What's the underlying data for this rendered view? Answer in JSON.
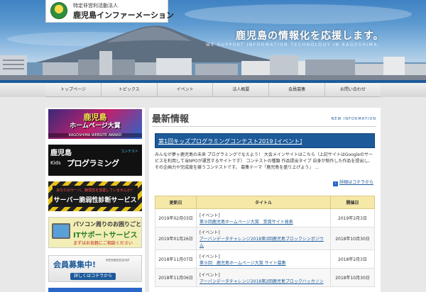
{
  "header": {
    "logo_sub": "特定非営利活動法人",
    "logo_main": "鹿児島インファーメーション",
    "tagline": "鹿児島の情報化を応援します。",
    "tagline_en": "WE SUPPORT INFORMATION TECHNOLOGY IN KAGOSHIMA."
  },
  "nav": {
    "items": [
      "トップページ",
      "トピックス",
      "イベント",
      "法人概要",
      "会員募集",
      "お問い合わせ"
    ]
  },
  "sidebar": {
    "banner1": {
      "line1": "鹿児島",
      "line2": "ホームページ大賞",
      "line3": "KAGOSHIMA WEBSITE AWARD"
    },
    "banner2": {
      "line1": "鹿児島",
      "line2": "Kids",
      "line3": "プログラミング",
      "line4": "コンテスト"
    },
    "banner3": {
      "line1": "あなたのサーバ、脆弱性を放置していませんか？",
      "line2": "サーバー脆弱性診断サービス"
    },
    "banner4": {
      "line1": "パソコン周りのお困りごと",
      "line2": "ITサポートサービス",
      "line3": "まずはお気軽にご相談ください"
    },
    "banner5": {
      "line1": "会員募集中!",
      "line2": "MEMBERSHIP",
      "line3": "詳しくはコチラから"
    }
  },
  "main": {
    "title": "最新情報",
    "title_en": "NEW INFORMATION",
    "article": {
      "heading": "第1回キッズプログラミングコンテスト2019 [イベント]",
      "body": "みんなが夢ヶ鹿児島の未来 プログラミングでなえよう！ 大会メインサイトはこちら（上記サイトはGoogleのサービスを利用して当NPOが運営するサイトです） コンテストの種類 作品提出タイプ 自身が制作した作品を提出し、その企画力や完成度を競うコンテストです。 募集テーマ「鹿児島を盛り上げよう」 …",
      "more": "詳細はコチラから"
    },
    "table": {
      "headers": [
        "更新日",
        "タイトル",
        "開催日"
      ],
      "rows": [
        {
          "date": "2019年02月03日",
          "tag": "[イベント]",
          "title": "第９回鹿児島ホームページ大賞　受賞サイト発表",
          "event_date": "2019年2月3日"
        },
        {
          "date": "2019年01月26日",
          "tag": "[イベント]",
          "title": "アーバンデータチャレンジ2018第3回鹿児島ブロックシンポジウム",
          "event_date": "2018年10月30日"
        },
        {
          "date": "2018年11月07日",
          "tag": "[イベント]",
          "title": "第９回　鹿児島ホームページ大賞 サイト募集",
          "event_date": "2018年2月3日"
        },
        {
          "date": "2018年11月06日",
          "tag": "[イベント]",
          "title": "アーバンデータチャレンジ2018第2回鹿児島ブロックハッカソン",
          "event_date": "2018年10月30日"
        }
      ]
    }
  }
}
